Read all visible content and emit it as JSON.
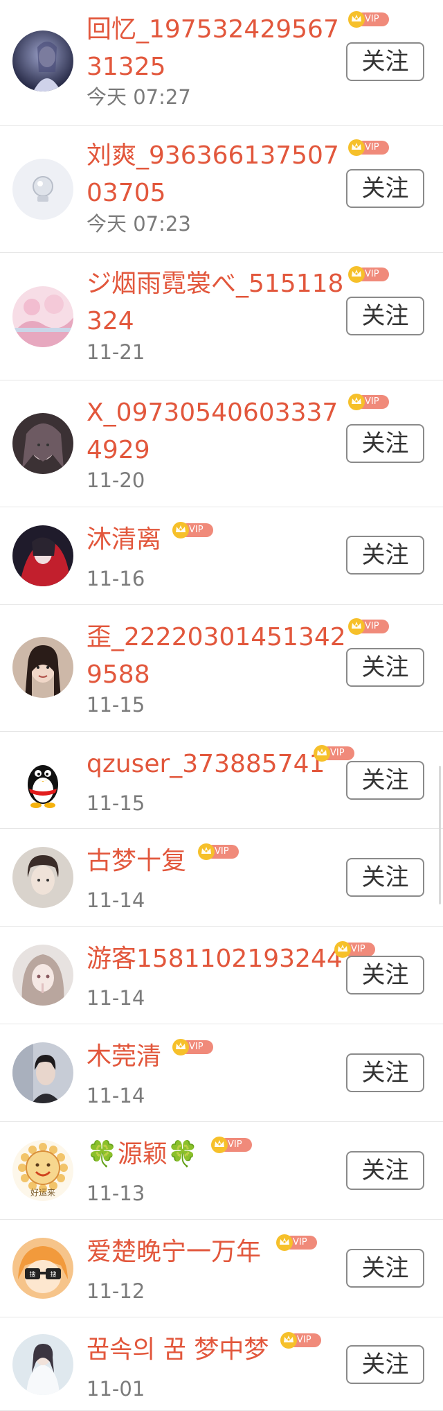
{
  "follow_label": "关注",
  "users": [
    {
      "name": "回忆_19753242956731325",
      "time": "今天 07:27",
      "avatar": "dark-portrait"
    },
    {
      "name": "刘爽_93636613750703705",
      "time": "今天 07:23",
      "avatar": "crystal-ball"
    },
    {
      "name": "ジ烟雨霓裳べ_515118324",
      "time": "11-21",
      "avatar": "pink-landscape"
    },
    {
      "name": "X_097305406033374929",
      "time": "11-20",
      "avatar": "anime-girl-dark"
    },
    {
      "name": "沐清离",
      "time": "11-16",
      "avatar": "red-anime"
    },
    {
      "name": "歪_222203014513429588",
      "time": "11-15",
      "avatar": "girl-photo"
    },
    {
      "name": "qzuser_373885741",
      "time": "11-15",
      "avatar": "qq-penguin"
    },
    {
      "name": "古梦十复",
      "time": "11-14",
      "avatar": "boy-portrait"
    },
    {
      "name": "游客1581102193244",
      "time": "11-14",
      "avatar": "anime-girl-light"
    },
    {
      "name": "木莞清",
      "time": "11-14",
      "avatar": "boy-photo"
    },
    {
      "name": "🍀源颖🍀",
      "time": "11-13",
      "avatar": "sun-smile",
      "avatar_text": "好运来"
    },
    {
      "name": "爱楚晚宁一万年",
      "time": "11-12",
      "avatar": "umaru-sunglasses",
      "avatar_text": "搜"
    },
    {
      "name": "꿈속의 꿈 梦中梦",
      "time": "11-01",
      "avatar": "white-dress-girl"
    }
  ],
  "vip_label": "VIP",
  "colors": {
    "name": "#e2573c",
    "time": "#7b7b7b",
    "vip_crown": "#f6c02a",
    "vip_badge": "#f08a7a",
    "divider": "#e6e6e6",
    "button_border": "#8a8a8a"
  }
}
